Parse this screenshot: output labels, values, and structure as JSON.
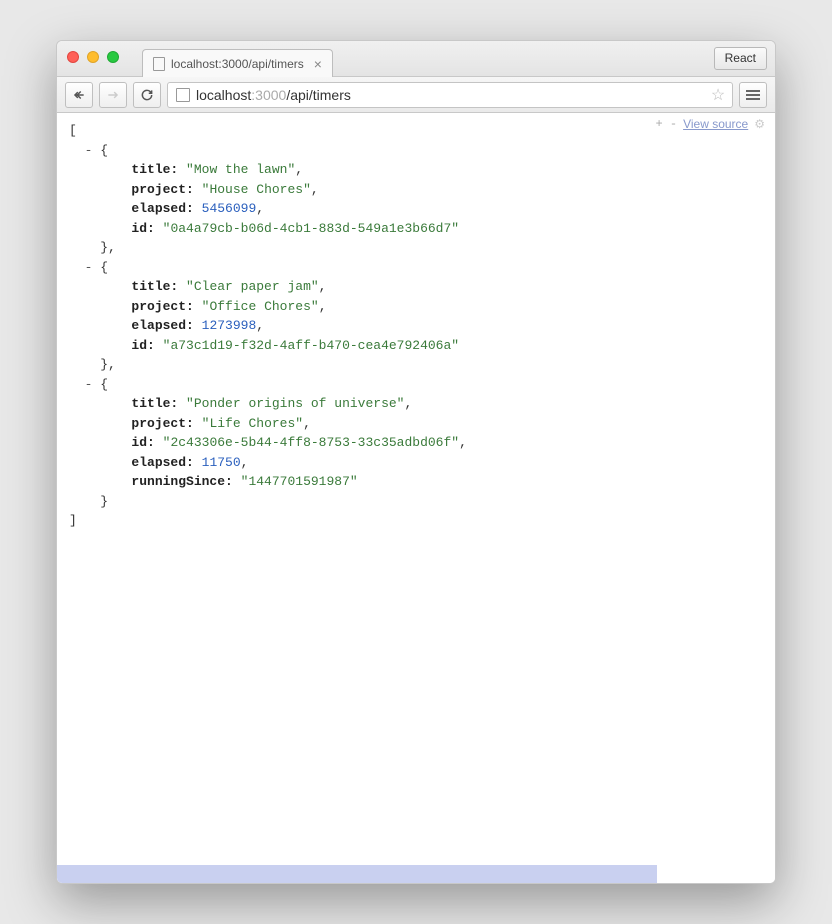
{
  "browser": {
    "tab_title": "localhost:3000/api/timers",
    "url_display": {
      "host_dark": "localhost",
      "host_light": ":3000",
      "path": "/api/timers"
    },
    "react_devtools_label": "React",
    "view_source_label": "View source",
    "expand_collapse": "+ -"
  },
  "json_response": [
    {
      "title": "Mow the lawn",
      "project": "House Chores",
      "elapsed": 5456099,
      "id": "0a4a79cb-b06d-4cb1-883d-549a1e3b66d7"
    },
    {
      "title": "Clear paper jam",
      "project": "Office Chores",
      "elapsed": 1273998,
      "id": "a73c1d19-f32d-4aff-b470-cea4e792406a"
    },
    {
      "title": "Ponder origins of universe",
      "project": "Life Chores",
      "id": "2c43306e-5b44-4ff8-8753-33c35adbd06f",
      "elapsed": 11750,
      "runningSince": "1447701591987"
    }
  ],
  "json_key_orders": [
    [
      "title",
      "project",
      "elapsed",
      "id"
    ],
    [
      "title",
      "project",
      "elapsed",
      "id"
    ],
    [
      "title",
      "project",
      "id",
      "elapsed",
      "runningSince"
    ]
  ]
}
